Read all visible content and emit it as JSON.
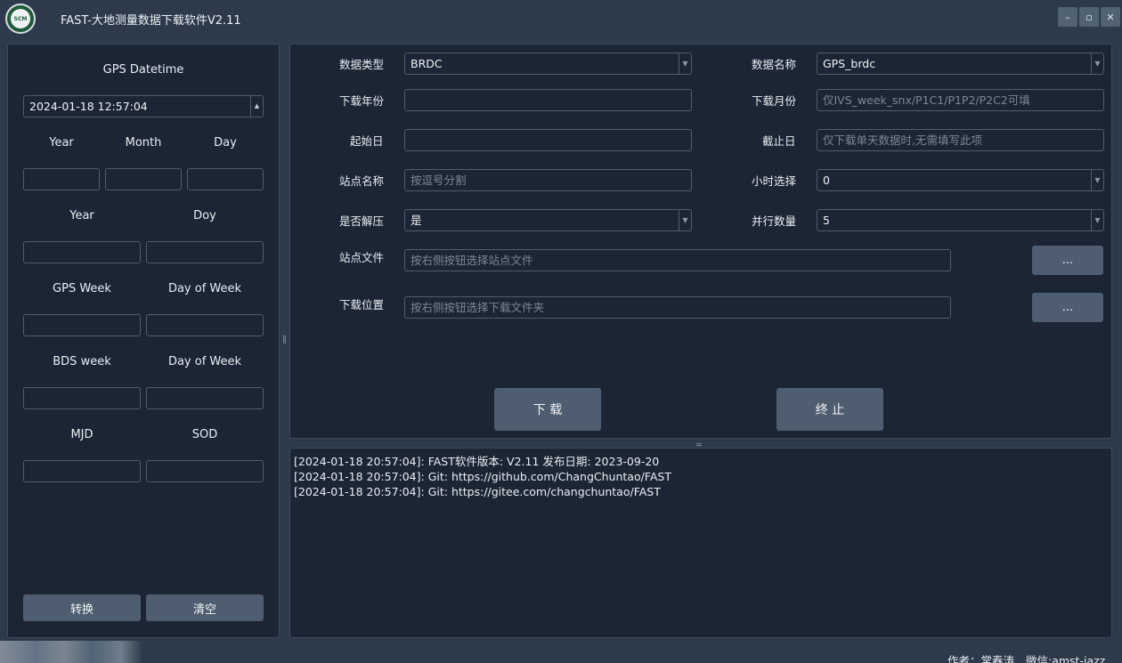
{
  "window": {
    "title": "FAST-大地测量数据下载软件V2.11",
    "logo_text": "SCM",
    "controls": {
      "minimize": "–",
      "maximize": "▫",
      "close": "✕"
    }
  },
  "left": {
    "gps_datetime_label": "GPS Datetime",
    "datetime_value": "2024-01-18  12:57:04",
    "year_label": "Year",
    "month_label": "Month",
    "day_label": "Day",
    "year2_label": "Year",
    "doy_label": "Doy",
    "gps_week_label": "GPS Week",
    "dow_label": "Day of Week",
    "bds_week_label": "BDS week",
    "dow2_label": "Day of Week",
    "mjd_label": "MJD",
    "sod_label": "SOD",
    "convert_button": "转换",
    "clear_button": "清空"
  },
  "form": {
    "data_type_label": "数据类型",
    "data_type_value": "BRDC",
    "data_name_label": "数据名称",
    "data_name_value": "GPS_brdc",
    "year_label": "下载年份",
    "month_label": "下载月份",
    "month_placeholder": "仅IVS_week_snx/P1C1/P1P2/P2C2可填",
    "start_day_label": "起始日",
    "end_day_label": "截止日",
    "end_day_placeholder": "仅下载单天数据时,无需填写此项",
    "station_name_label": "站点名称",
    "station_name_placeholder": "按逗号分割",
    "hour_label": "小时选择",
    "hour_value": "0",
    "unzip_label": "是否解压",
    "unzip_value": "是",
    "parallel_label": "并行数量",
    "parallel_value": "5",
    "station_file_label": "站点文件",
    "station_file_placeholder": "按右侧按钮选择站点文件",
    "browse_label": "...",
    "download_dir_label": "下载位置",
    "download_dir_placeholder": "按右侧按钮选择下载文件夹",
    "browse2_label": "...",
    "download_button": "下 载",
    "stop_button": "终 止"
  },
  "log": {
    "lines": [
      "[2024-01-18 20:57:04]: FAST软件版本: V2.11 发布日期: 2023-09-20",
      "[2024-01-18 20:57:04]: Git: https://github.com/ChangChuntao/FAST",
      "[2024-01-18 20:57:04]: Git: https://gitee.com/changchuntao/FAST"
    ]
  },
  "footer": {
    "author": "作者：常春涛",
    "wechat": "微信:amst-jazz"
  },
  "colors": {
    "window_bg": "#2c3a4b",
    "panel_bg": "#1b2533",
    "button_bg": "#4e5e70",
    "border": "#4e5e70"
  }
}
